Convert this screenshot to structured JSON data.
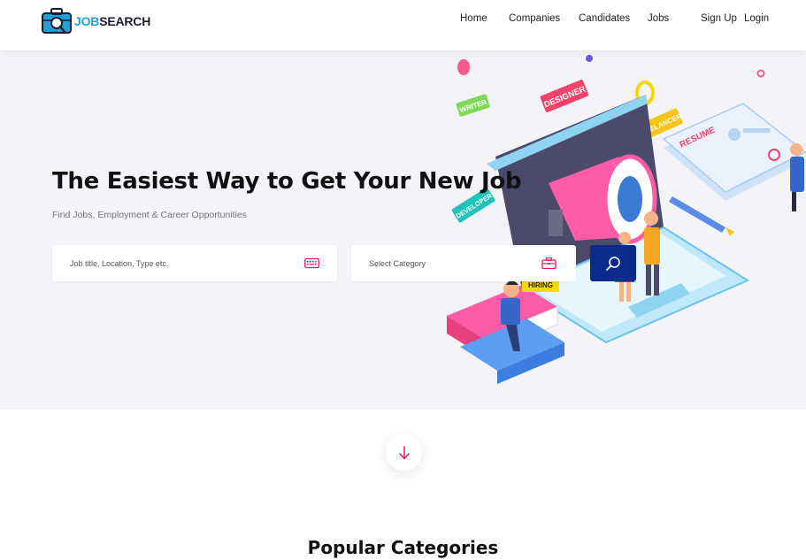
{
  "logo": {
    "part1": "JOB",
    "part2": "SEARCH",
    "icon": "briefcase-search-icon"
  },
  "nav": {
    "home": "Home",
    "companies": "Companies",
    "candidates": "Candidates",
    "jobs": "Jobs",
    "signup": "Sign Up",
    "login": "Login"
  },
  "hero": {
    "title": "The Easiest Way to Get Your New Job",
    "subtitle": "Find Jobs, Employment & Career Opportunities",
    "keyword_placeholder": "Job title, Location, Type etc.",
    "category_placeholder": "Select Category",
    "illustration_tags": [
      "WRITER",
      "DESIGNER",
      "FREELANCER",
      "DEVELOPER",
      "RESUME",
      "HIRING"
    ]
  },
  "sections": {
    "popular_title": "Popular Categories"
  },
  "colors": {
    "accent": "#e8175d",
    "primary": "#0b2a8c",
    "hero_bg": "#f3f3f8",
    "brand": "#1aa3d9"
  }
}
